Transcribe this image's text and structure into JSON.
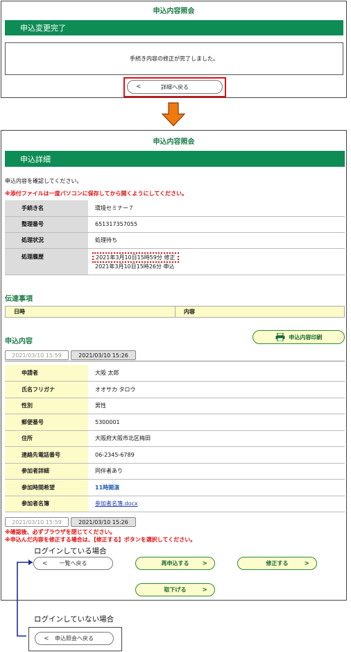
{
  "top": {
    "title": "申込内容照会",
    "header": "申込変更完了",
    "message": "手続き内容の修正が完了しました。",
    "back_button": "詳細へ戻る"
  },
  "detail": {
    "title": "申込内容照会",
    "header": "申込詳細",
    "confirm_text": "申込内容を確認してください。",
    "attachment_warning": "※添付ファイルは一度パソコンに保存してから開くようにしてください。",
    "rows": [
      {
        "label": "手続き名",
        "value": "環境セミナー７"
      },
      {
        "label": "整理番号",
        "value": "651317357055"
      },
      {
        "label": "処理状況",
        "value": "処理待ち"
      },
      {
        "label": "処理履歴",
        "value": "2021年3月10日15時59分 修正",
        "value2": "2021年3月10日15時26分 申込"
      }
    ],
    "notice_title": "伝達事項",
    "notice_cols": [
      "日時",
      "内容"
    ],
    "content_title": "申込内容",
    "print_button": "申込内容印刷",
    "tabs": [
      "2021/03/10 15:59",
      "2021/03/10 15:26"
    ],
    "content_rows": [
      {
        "label": "申請者",
        "value": "大阪 太郎"
      },
      {
        "label": "氏名フリガナ",
        "value": "オオサカ タロウ"
      },
      {
        "label": "性別",
        "value": "男性"
      },
      {
        "label": "郵便番号",
        "value": "5300001"
      },
      {
        "label": "住所",
        "value": "大阪府大阪市北区梅田"
      },
      {
        "label": "連絡先電話番号",
        "value": "06-2345-6789"
      },
      {
        "label": "参加者詳細",
        "value": "同伴者あり"
      },
      {
        "label": "参加時間希望",
        "value": "11時開演"
      },
      {
        "label": "参加者名簿",
        "value": "参加者名簿.docx"
      }
    ],
    "warn1": "※確認後、必ずブラウザを閉じてください。",
    "warn2": "※申込んだ内容を修正する場合は、【修正する】ボタンを選択してください。",
    "list_back": "一覧へ戻る",
    "reapply": "再申込する",
    "modify": "修正する",
    "withdraw": "取下げる"
  },
  "annotations": {
    "logged_in": "ログインしている場合",
    "logged_out": "ログインしていない場合",
    "inquiry_back": "申込照会へ戻る"
  },
  "colors": {
    "green": "#0e8c55",
    "red_highlight": "#e01010",
    "orange_arrow": "#f07a10",
    "yellow": "#fdfcc8"
  }
}
